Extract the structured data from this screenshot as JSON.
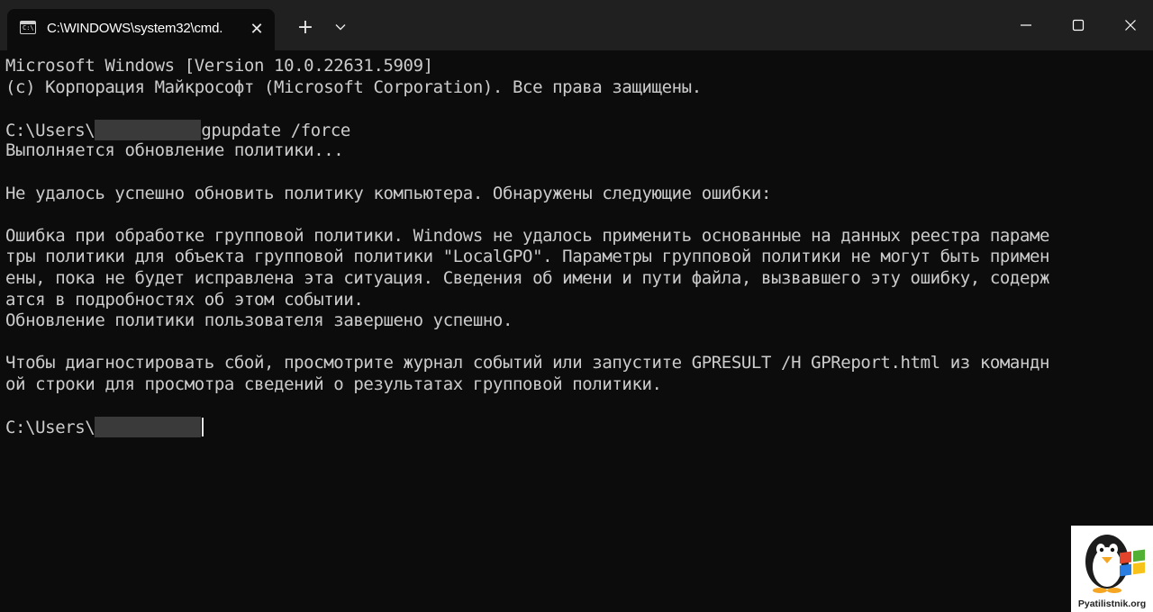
{
  "window": {
    "tab_title": "C:\\WINDOWS\\system32\\cmd.",
    "tab_close_glyph": "✕",
    "new_tab_glyph": "+",
    "icons": {
      "tab": "cmd-console-icon",
      "dropdown": "chevron-down-icon",
      "minimize": "minimize-icon",
      "maximize": "maximize-icon",
      "close": "close-icon"
    }
  },
  "terminal": {
    "lines": [
      "Microsoft Windows [Version 10.0.22631.5909]",
      "(c) Корпорация Майкрософт (Microsoft Corporation). Все права защищены.",
      "",
      "C:\\Users\\",
      "Выполняется обновление политики...",
      "",
      "Не удалось успешно обновить политику компьютера. Обнаружены следующие ошибки:",
      "",
      "Ошибка при обработке групповой политики. Windows не удалось применить основанные на данных реестра параме",
      "тры политики для объекта групповой политики \"LocalGPO\". Параметры групповой политики не могут быть примен",
      "ены, пока не будет исправлена эта ситуация. Сведения об имени и пути файла, вызвавшего эту ошибку, содерж",
      "атся в подробностях об этом событии.",
      "Обновление политики пользователя завершено успешно.",
      "",
      "Чтобы диагностировать сбой, просмотрите журнал событий или запустите GPRESULT /H GPReport.html из командн",
      "ой строки для просмотра сведений о результатах групповой политики.",
      "",
      "C:\\Users\\"
    ],
    "command": "gpupdate /force"
  },
  "watermark": {
    "text": "Pyatilistnik.org",
    "icon": "penguin-windows-logo-icon"
  },
  "colors": {
    "titlebar": "#202020",
    "terminal_bg": "#0c0c0c",
    "text": "#cccccc"
  }
}
